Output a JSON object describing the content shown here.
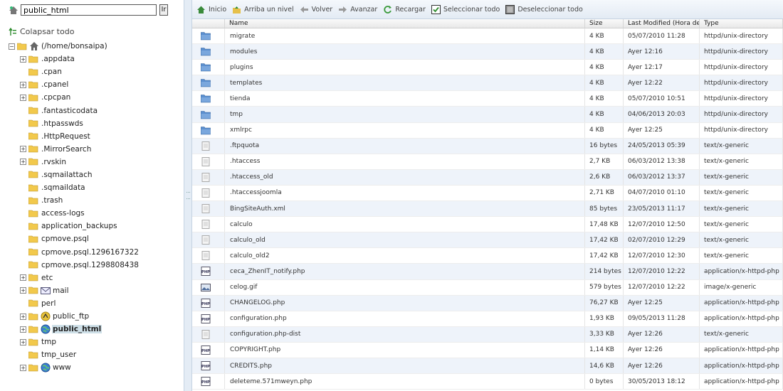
{
  "path_input": "public_html",
  "go_label": "Ir",
  "collapse_label": "Colapsar todo",
  "tree": {
    "root_label": "(/home/bonsaipa)",
    "items": [
      {
        "label": ".appdata",
        "expandable": true
      },
      {
        "label": ".cpan",
        "expandable": false
      },
      {
        "label": ".cpanel",
        "expandable": true
      },
      {
        "label": ".cpcpan",
        "expandable": true
      },
      {
        "label": ".fantasticodata",
        "expandable": false
      },
      {
        "label": ".htpasswds",
        "expandable": false
      },
      {
        "label": ".HttpRequest",
        "expandable": false
      },
      {
        "label": ".MirrorSearch",
        "expandable": true
      },
      {
        "label": ".rvskin",
        "expandable": true
      },
      {
        "label": ".sqmailattach",
        "expandable": false
      },
      {
        "label": ".sqmaildata",
        "expandable": false
      },
      {
        "label": ".trash",
        "expandable": false
      },
      {
        "label": "access-logs",
        "expandable": false
      },
      {
        "label": "application_backups",
        "expandable": false
      },
      {
        "label": "cpmove.psql",
        "expandable": false
      },
      {
        "label": "cpmove.psql.1296167322",
        "expandable": false
      },
      {
        "label": "cpmove.psql.1298808438",
        "expandable": false
      },
      {
        "label": "etc",
        "expandable": true
      },
      {
        "label": "mail",
        "expandable": true,
        "extra": "mail"
      },
      {
        "label": "perl",
        "expandable": false
      },
      {
        "label": "public_ftp",
        "expandable": true,
        "extra": "ftp"
      },
      {
        "label": "public_html",
        "expandable": true,
        "extra": "globe",
        "selected": true
      },
      {
        "label": "tmp",
        "expandable": true
      },
      {
        "label": "tmp_user",
        "expandable": false
      },
      {
        "label": "www",
        "expandable": true,
        "extra": "globe"
      }
    ]
  },
  "toolbar": {
    "home": "Inicio",
    "up": "Arriba un nivel",
    "back": "Volver",
    "forward": "Avanzar",
    "reload": "Recargar",
    "select_all": "Seleccionar todo",
    "deselect_all": "Deseleccionar todo"
  },
  "columns": {
    "name": "Name",
    "size": "Size",
    "modified": "Last Modified (Hora de ve",
    "type": "Type"
  },
  "files": [
    {
      "icon": "folder",
      "name": "migrate",
      "size": "4 KB",
      "modified": "05/07/2010 11:28",
      "type": "httpd/unix-directory"
    },
    {
      "icon": "folder",
      "name": "modules",
      "size": "4 KB",
      "modified": "Ayer 12:16",
      "type": "httpd/unix-directory"
    },
    {
      "icon": "folder",
      "name": "plugins",
      "size": "4 KB",
      "modified": "Ayer 12:17",
      "type": "httpd/unix-directory"
    },
    {
      "icon": "folder",
      "name": "templates",
      "size": "4 KB",
      "modified": "Ayer 12:22",
      "type": "httpd/unix-directory"
    },
    {
      "icon": "folder",
      "name": "tienda",
      "size": "4 KB",
      "modified": "05/07/2010 10:51",
      "type": "httpd/unix-directory"
    },
    {
      "icon": "folder",
      "name": "tmp",
      "size": "4 KB",
      "modified": "04/06/2013 20:03",
      "type": "httpd/unix-directory"
    },
    {
      "icon": "folder",
      "name": "xmlrpc",
      "size": "4 KB",
      "modified": "Ayer 12:25",
      "type": "httpd/unix-directory"
    },
    {
      "icon": "generic",
      "name": ".ftpquota",
      "size": "16 bytes",
      "modified": "24/05/2013 05:39",
      "type": "text/x-generic"
    },
    {
      "icon": "generic",
      "name": ".htaccess",
      "size": "2,7 KB",
      "modified": "06/03/2012 13:38",
      "type": "text/x-generic"
    },
    {
      "icon": "generic",
      "name": ".htaccess_old",
      "size": "2,6 KB",
      "modified": "06/03/2012 13:37",
      "type": "text/x-generic"
    },
    {
      "icon": "generic",
      "name": ".htaccessjoomla",
      "size": "2,71 KB",
      "modified": "04/07/2010 01:10",
      "type": "text/x-generic"
    },
    {
      "icon": "generic",
      "name": "BingSiteAuth.xml",
      "size": "85 bytes",
      "modified": "23/05/2013 11:17",
      "type": "text/x-generic"
    },
    {
      "icon": "generic",
      "name": "calculo",
      "size": "17,48 KB",
      "modified": "12/07/2010 12:50",
      "type": "text/x-generic"
    },
    {
      "icon": "generic",
      "name": "calculo_old",
      "size": "17,42 KB",
      "modified": "02/07/2010 12:29",
      "type": "text/x-generic"
    },
    {
      "icon": "generic",
      "name": "calculo_old2",
      "size": "17,42 KB",
      "modified": "12/07/2010 12:30",
      "type": "text/x-generic"
    },
    {
      "icon": "php",
      "name": "ceca_ZhenIT_notify.php",
      "size": "214 bytes",
      "modified": "12/07/2010 12:22",
      "type": "application/x-httpd-php"
    },
    {
      "icon": "image",
      "name": "celog.gif",
      "size": "579 bytes",
      "modified": "12/07/2010 12:22",
      "type": "image/x-generic"
    },
    {
      "icon": "php",
      "name": "CHANGELOG.php",
      "size": "76,27 KB",
      "modified": "Ayer 12:25",
      "type": "application/x-httpd-php"
    },
    {
      "icon": "php",
      "name": "configuration.php",
      "size": "1,93 KB",
      "modified": "09/05/2013 11:28",
      "type": "application/x-httpd-php"
    },
    {
      "icon": "generic",
      "name": "configuration.php-dist",
      "size": "3,33 KB",
      "modified": "Ayer 12:26",
      "type": "text/x-generic"
    },
    {
      "icon": "php",
      "name": "COPYRIGHT.php",
      "size": "1,14 KB",
      "modified": "Ayer 12:26",
      "type": "application/x-httpd-php"
    },
    {
      "icon": "php",
      "name": "CREDITS.php",
      "size": "14,6 KB",
      "modified": "Ayer 12:26",
      "type": "application/x-httpd-php"
    },
    {
      "icon": "php",
      "name": "deleteme.571mweyn.php",
      "size": "0 bytes",
      "modified": "30/05/2013 18:12",
      "type": "application/x-httpd-php"
    }
  ],
  "icon_labels": {
    "php": "PHP"
  },
  "colors": {
    "folder_tree": "#f2c94c",
    "folder_grid": "#5b8fcf",
    "alt_row": "#eef3fa",
    "selected": "#cfe0e8"
  }
}
